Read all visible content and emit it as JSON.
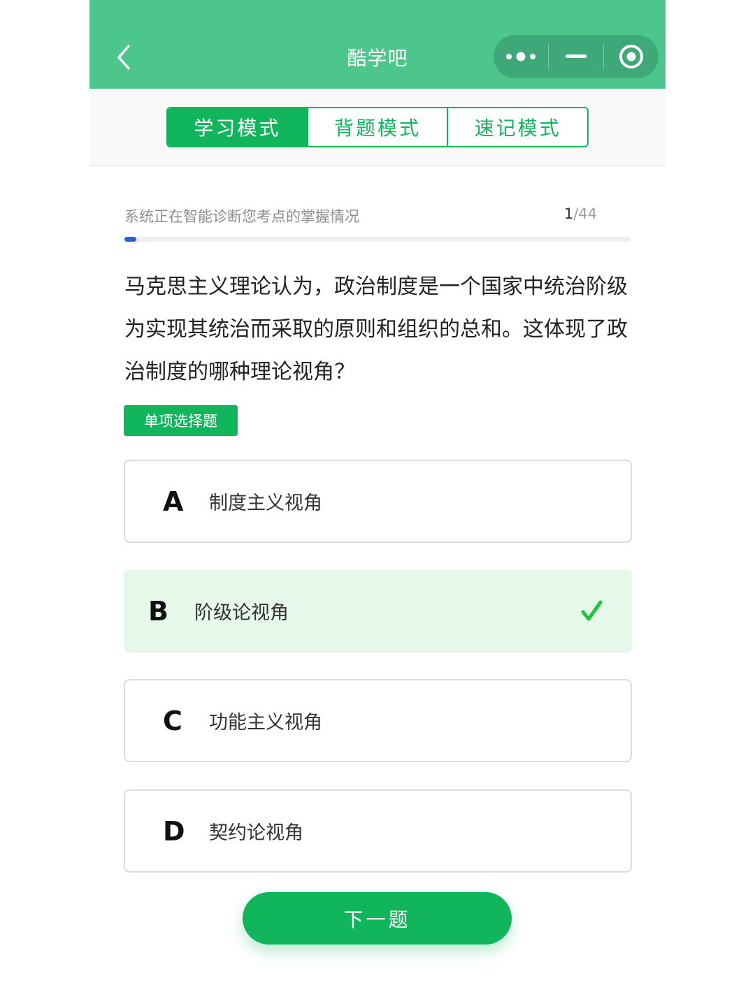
{
  "header": {
    "title": "酷学吧",
    "back_icon": "chevron-left-icon",
    "menu_icon": "more-dots-icon",
    "minimize_icon": "minus-icon",
    "close_icon": "target-circle-icon"
  },
  "modes": {
    "active_index": 0,
    "tabs": [
      {
        "label": "学习模式"
      },
      {
        "label": "背题模式"
      },
      {
        "label": "速记模式"
      }
    ]
  },
  "progress": {
    "label": "系统正在智能诊断您考点的掌握情况",
    "current": "1",
    "separator": "/",
    "total": "44",
    "fraction": 0.023
  },
  "question": {
    "text": "马克思主义理论认为，政治制度是一个国家中统治阶级为实现其统治而采取的原则和组织的总和。这体现了政治制度的哪种理论视角？",
    "type_label": "单项选择题"
  },
  "options": [
    {
      "letter": "A",
      "text": "制度主义视角",
      "selected": false
    },
    {
      "letter": "B",
      "text": "阶级论视角",
      "selected": true
    },
    {
      "letter": "C",
      "text": "功能主义视角",
      "selected": false
    },
    {
      "letter": "D",
      "text": "契约论视角",
      "selected": false
    }
  ],
  "actions": {
    "next_label": "下一题"
  },
  "colors": {
    "header_bg": "#4cc68a",
    "primary": "#11b65c",
    "progress_fill": "#2f5fd6",
    "selected_bg": "#e6f8ea"
  }
}
